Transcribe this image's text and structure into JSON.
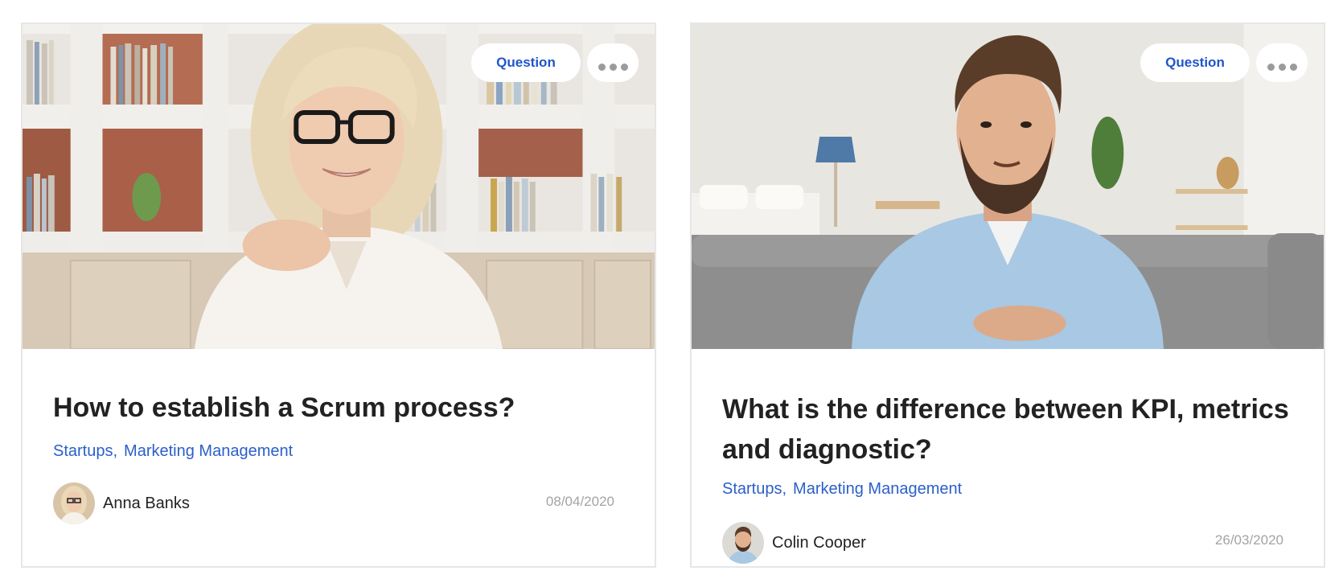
{
  "cards": [
    {
      "badge_label": "Question",
      "title": "How to establish a Scrum process?",
      "tags": [
        "Startups,",
        "Marketing Management"
      ],
      "author": "Anna Banks",
      "date": "08/04/2020"
    },
    {
      "badge_label": "Question",
      "title": "What is the difference between KPI, metrics and diagnostic?",
      "tags": [
        "Startups,",
        "Marketing Management"
      ],
      "author": "Colin Cooper",
      "date": "26/03/2020"
    }
  ],
  "icons": {
    "more": "more-dots-icon"
  },
  "colors": {
    "accent": "#1f56c9",
    "tag": "#2b5fc9",
    "date": "#a3a3a3",
    "title": "#222222",
    "border": "#e6e6e6"
  }
}
